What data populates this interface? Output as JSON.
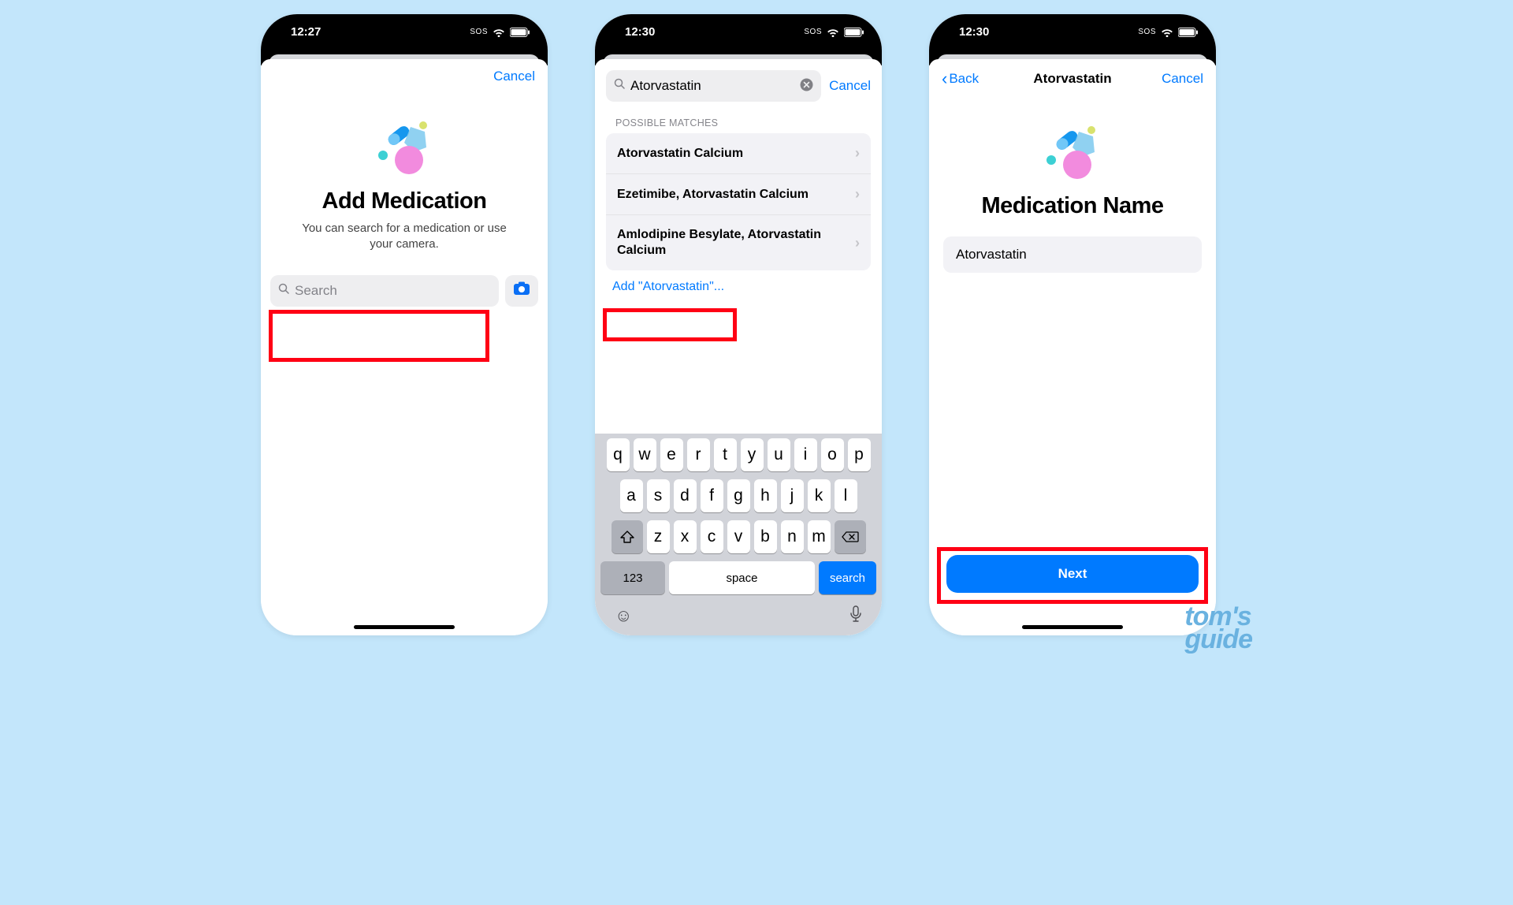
{
  "watermark": {
    "line1": "tom's",
    "line2": "guide"
  },
  "common": {
    "sos": "SOS",
    "cancel": "Cancel"
  },
  "screen1": {
    "time": "12:27",
    "heading": "Add Medication",
    "subtext": "You can search for a medication or use your camera.",
    "search_placeholder": "Search"
  },
  "screen2": {
    "time": "12:30",
    "search_value": "Atorvastatin",
    "section_label": "POSSIBLE MATCHES",
    "results": [
      "Atorvastatin Calcium",
      "Ezetimibe, Atorvastatin Calcium",
      "Amlodipine Besylate, Atorvastatin Calcium"
    ],
    "add_custom": "Add \"Atorvastatin\"...",
    "keyboard": {
      "row1": [
        "q",
        "w",
        "e",
        "r",
        "t",
        "y",
        "u",
        "i",
        "o",
        "p"
      ],
      "row2": [
        "a",
        "s",
        "d",
        "f",
        "g",
        "h",
        "j",
        "k",
        "l"
      ],
      "row3": [
        "z",
        "x",
        "c",
        "v",
        "b",
        "n",
        "m"
      ],
      "numbers": "123",
      "space": "space",
      "search": "search"
    }
  },
  "screen3": {
    "time": "12:30",
    "back": "Back",
    "title": "Atorvastatin",
    "heading": "Medication Name",
    "field_value": "Atorvastatin",
    "next": "Next"
  }
}
